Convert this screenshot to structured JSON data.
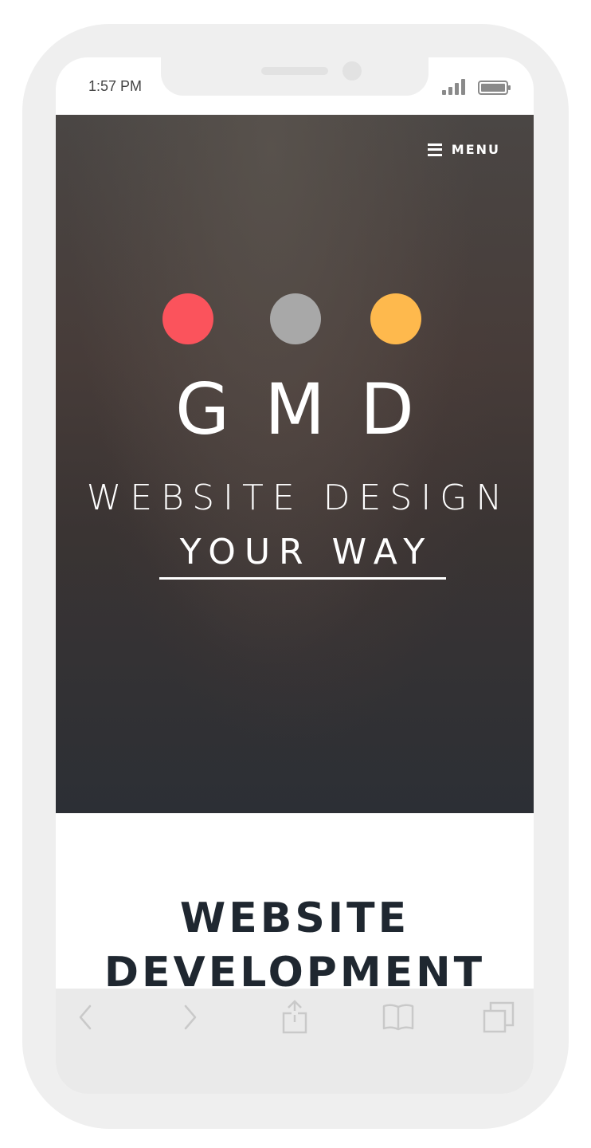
{
  "status_bar": {
    "time": "1:57 PM"
  },
  "hero": {
    "menu_label": "MENU",
    "logo_letters": "GMD",
    "tagline_line1": "WEBSITE DESIGN",
    "tagline_line2": "YOUR WAY",
    "dot_colors": [
      "#fb535c",
      "#a8a8a8",
      "#feb94d"
    ]
  },
  "content": {
    "title_line1": "WEBSITE",
    "title_line2": "DEVELOPMENT"
  },
  "toolbar": {
    "icons": [
      "back-icon",
      "forward-icon",
      "share-icon",
      "bookmarks-icon",
      "tabs-icon"
    ]
  },
  "colors": {
    "frame": "#efefef",
    "heading": "#1f2730"
  }
}
